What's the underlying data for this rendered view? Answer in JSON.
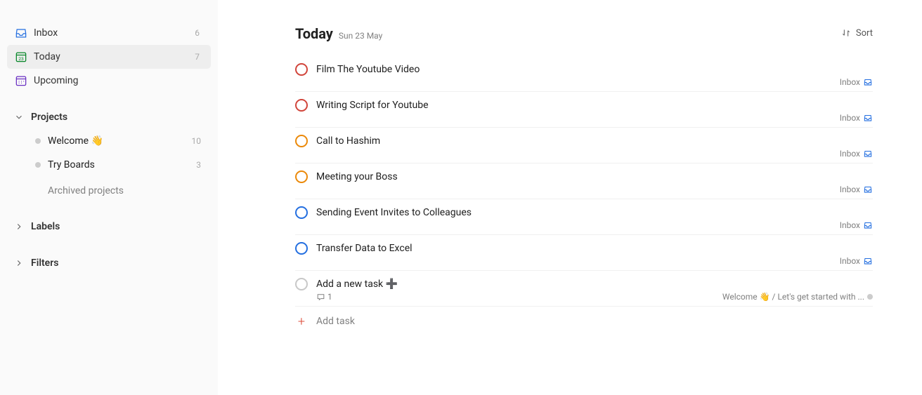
{
  "sidebar": {
    "nav": [
      {
        "label": "Inbox",
        "count": "6",
        "icon": "inbox",
        "active": false
      },
      {
        "label": "Today",
        "count": "7",
        "icon": "today",
        "active": true
      },
      {
        "label": "Upcoming",
        "count": "",
        "icon": "upcoming",
        "active": false
      }
    ],
    "projects_header": "Projects",
    "projects": [
      {
        "label": "Welcome 👋",
        "count": "10"
      },
      {
        "label": "Try Boards",
        "count": "3"
      }
    ],
    "archived_label": "Archived projects",
    "labels_header": "Labels",
    "filters_header": "Filters"
  },
  "header": {
    "title": "Today",
    "subtitle": "Sun 23 May",
    "sort_label": "Sort"
  },
  "tasks": [
    {
      "title": "Film The Youtube Video",
      "priority": "p1",
      "project": "Inbox",
      "project_icon": "inbox"
    },
    {
      "title": "Writing Script for Youtube",
      "priority": "p1",
      "project": "Inbox",
      "project_icon": "inbox"
    },
    {
      "title": "Call to Hashim",
      "priority": "p2",
      "project": "Inbox",
      "project_icon": "inbox"
    },
    {
      "title": "Meeting your Boss",
      "priority": "p2",
      "project": "Inbox",
      "project_icon": "inbox"
    },
    {
      "title": "Sending Event Invites to Colleagues",
      "priority": "p3",
      "project": "Inbox",
      "project_icon": "inbox"
    },
    {
      "title": "Transfer Data to Excel",
      "priority": "p3",
      "project": "Inbox",
      "project_icon": "inbox"
    },
    {
      "title": "Add a new task ➕",
      "priority": "p4",
      "project": "Welcome 👋 / Let's get started with ...",
      "project_icon": "dot",
      "comments": "1"
    }
  ],
  "add_task_label": "Add task"
}
